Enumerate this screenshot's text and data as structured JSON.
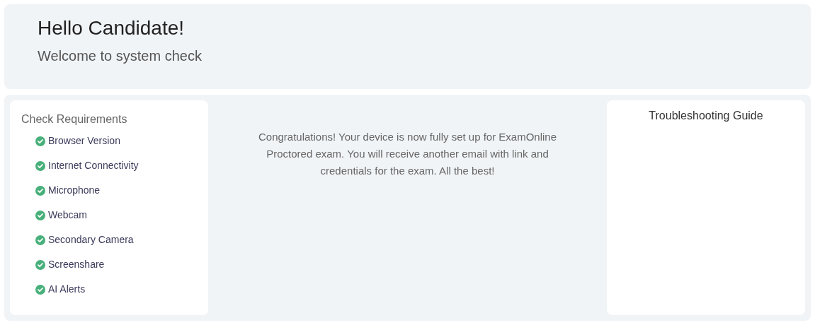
{
  "header": {
    "greeting": "Hello Candidate!",
    "subtitle": "Welcome to system check"
  },
  "requirements": {
    "title": "Check Requirements",
    "items": [
      {
        "label": "Browser Version",
        "passed": true
      },
      {
        "label": "Internet Connectivity",
        "passed": true
      },
      {
        "label": "Microphone",
        "passed": true
      },
      {
        "label": "Webcam",
        "passed": true
      },
      {
        "label": "Secondary Camera",
        "passed": true
      },
      {
        "label": "Screenshare",
        "passed": true
      },
      {
        "label": "AI Alerts",
        "passed": true
      }
    ]
  },
  "message": "Congratulations! Your device is now fully set up for ExamOnline Proctored exam. You will receive another email with link and credentials for the exam. All the best!",
  "troubleshooting": {
    "title": "Troubleshooting Guide"
  }
}
